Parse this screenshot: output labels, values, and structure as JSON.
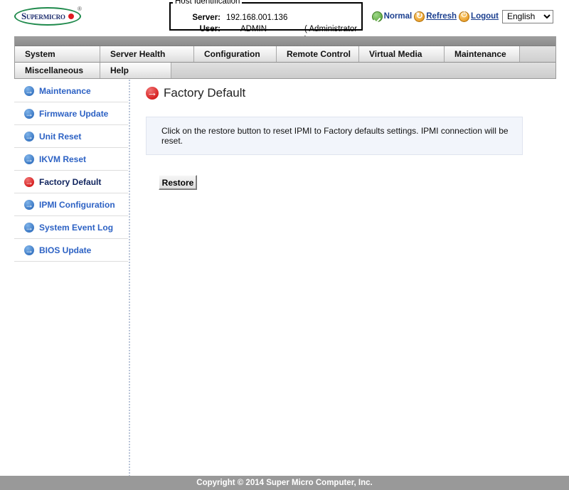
{
  "brand": {
    "logo_text": "Supermicro",
    "logo_trademark": "®"
  },
  "host_identification": {
    "legend": "Host Identification",
    "server_label": "Server:",
    "server_value": "192.168.001.136",
    "user_label": "User:",
    "user_value": "ADMIN",
    "user_role": "( Administrator )"
  },
  "topnav": {
    "status_label": "Normal",
    "refresh_label": "Refresh",
    "logout_label": "Logout",
    "language_selected": "English",
    "language_options": [
      "English"
    ],
    "status_icon": "green-check-icon",
    "refresh_icon": "refresh-circle-icon",
    "logout_icon": "power-icon",
    "status_color": "#4f9e30",
    "link_color": "#1b3f8f"
  },
  "menubar": {
    "row1": [
      "System",
      "Server Health",
      "Configuration",
      "Remote Control",
      "Virtual Media",
      "Maintenance"
    ],
    "row2": [
      "Miscellaneous",
      "Help"
    ]
  },
  "sidebar": {
    "items": [
      {
        "label": "Maintenance",
        "selected": false
      },
      {
        "label": "Firmware Update",
        "selected": false
      },
      {
        "label": "Unit Reset",
        "selected": false
      },
      {
        "label": "IKVM Reset",
        "selected": false
      },
      {
        "label": "Factory Default",
        "selected": true
      },
      {
        "label": "IPMI Configuration",
        "selected": false
      },
      {
        "label": "System Event Log",
        "selected": false
      },
      {
        "label": "BIOS Update",
        "selected": false
      }
    ],
    "item_color": "#2d62c4",
    "selected_color": "#10245e"
  },
  "main": {
    "page_title": "Factory Default",
    "info_text": "Click on the restore button to reset IPMI to Factory defaults settings. IPMI connection will be reset.",
    "restore_label": "Restore"
  },
  "footer": {
    "copyright": "Copyright © 2014 Super Micro Computer, Inc."
  }
}
